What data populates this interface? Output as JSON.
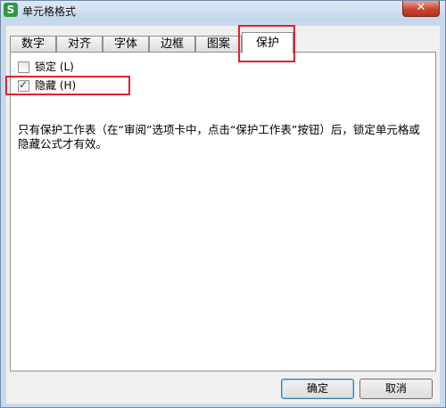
{
  "window": {
    "title": "单元格格式",
    "app_icon_glyph": "S",
    "close_glyph": "✕"
  },
  "tabs": [
    {
      "label": "数字",
      "active": false
    },
    {
      "label": "对齐",
      "active": false
    },
    {
      "label": "字体",
      "active": false
    },
    {
      "label": "边框",
      "active": false
    },
    {
      "label": "图案",
      "active": false
    },
    {
      "label": "保护",
      "active": true
    }
  ],
  "protection": {
    "locked": {
      "label": "锁定 (L)",
      "checked": false
    },
    "hidden": {
      "label": "隐藏 (H)",
      "checked": true
    },
    "description": "只有保护工作表（在“审阅”选项卡中，点击“保护工作表”按钮）后，锁定单元格或隐藏公式才有效。"
  },
  "buttons": {
    "ok": "确定",
    "cancel": "取消"
  },
  "colors": {
    "highlight": "#e3202c",
    "app_icon": "#2e9a3e"
  }
}
